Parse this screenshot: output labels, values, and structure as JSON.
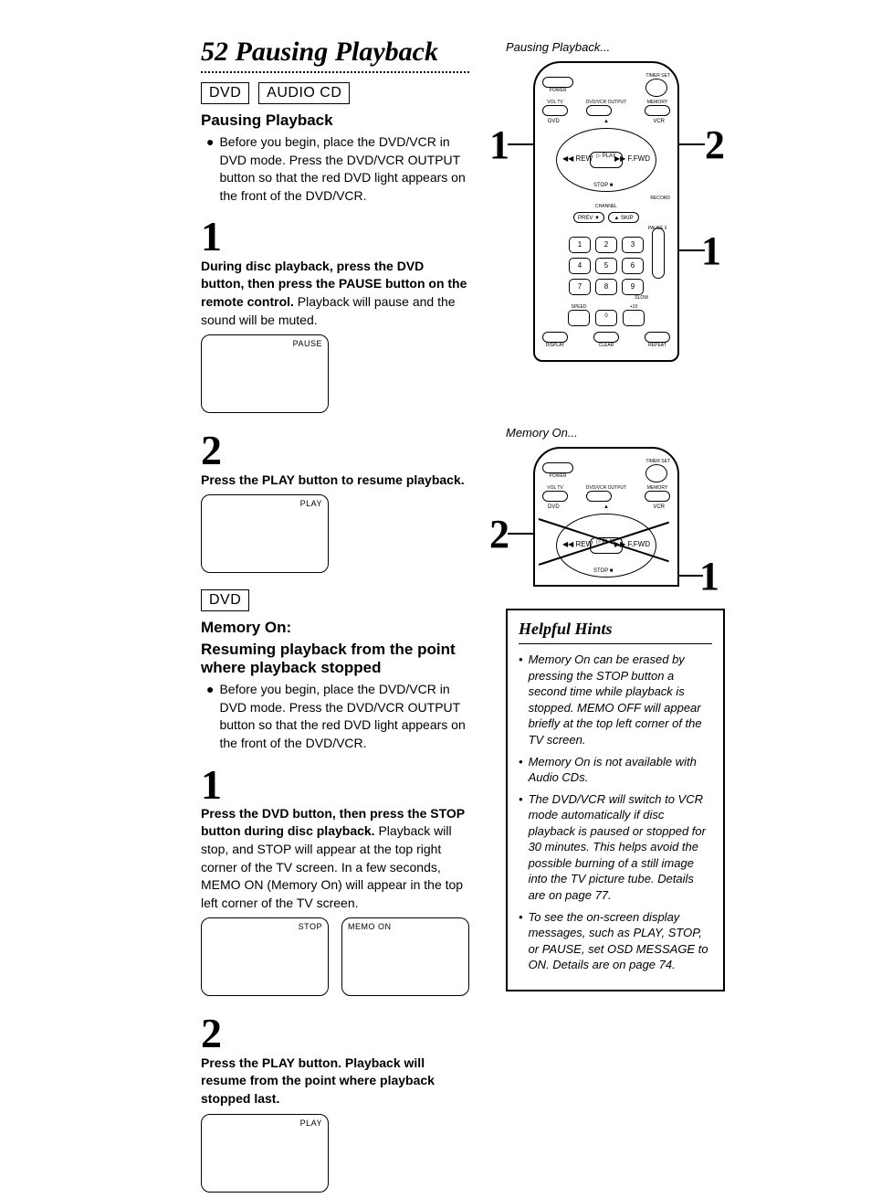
{
  "page_number": "52",
  "page_title": "Pausing Playback",
  "badges": {
    "dvd": "DVD",
    "audiocd": "AUDIO CD"
  },
  "sec1": {
    "heading": "Pausing Playback",
    "bullet": "Before you begin, place the DVD/VCR in DVD mode. Press the DVD/VCR OUTPUT button so that the red DVD light appears on the front of the DVD/VCR.",
    "step1_num": "1",
    "step1_b": "During disc playback, press the DVD button, then press the PAUSE button on the remote control.",
    "step1_r": " Playback will pause and the sound will be muted.",
    "tv_pause": "PAUSE",
    "step2_num": "2",
    "step2_b": "Press the PLAY button to resume playback.",
    "tv_play": "PLAY"
  },
  "sec2": {
    "badge": "DVD",
    "h1": "Memory On:",
    "h2": "Resuming playback from the point where playback stopped",
    "bullet": "Before you begin, place the DVD/VCR in DVD mode. Press the DVD/VCR OUTPUT button so that the red DVD light appears on the front of the DVD/VCR.",
    "step1_num": "1",
    "step1_b": "Press the DVD button, then press the STOP button during disc playback.",
    "step1_r": " Playback will stop, and STOP will appear at the top right corner of the TV screen. In a few seconds, MEMO ON (Memory On) will appear in the top left corner of the TV screen.",
    "tv_stop": "STOP",
    "tv_memo": "MEMO ON",
    "step2_num": "2",
    "step2_b": "Press the PLAY button. Playback will resume from the point where playback stopped last.",
    "tv_play": "PLAY"
  },
  "right": {
    "cap1": "Pausing Playback...",
    "cap2": "Memory On...",
    "indic1": "1",
    "indic2": "2",
    "remote": {
      "power": "POWER",
      "timerset": "TIMER SET",
      "volTv": "VOL TV",
      "dvdvcr": "DVD/VCR OUTPUT",
      "memory": "MEMORY",
      "dvd": "DVD",
      "vcr": "VCR",
      "play": "▷ PLAY",
      "rew": "◀◀ REW",
      "ffwd": "▶▶ F.FWD",
      "stop": "STOP ■",
      "record": "RECORD",
      "channel": "CHANNEL",
      "prev": "PREV ▼",
      "skip": "▲ SKIP",
      "speed": "SPEED",
      "plus10": "+10",
      "slow": "SLOW",
      "pause": "PAUSE ‖",
      "display": "DISPLAY",
      "clear": "CLEAR",
      "repeat": "REPEAT",
      "n1": "1",
      "n2": "2",
      "n3": "3",
      "n4": "4",
      "n5": "5",
      "n6": "6",
      "n7": "7",
      "n8": "8",
      "n9": "9",
      "n0": "0"
    }
  },
  "hints": {
    "title": "Helpful Hints",
    "i1": "Memory On can be erased by pressing the STOP button a second time while playback is stopped. MEMO OFF will appear briefly at the top left corner of the TV screen.",
    "i2": "Memory On is not available with Audio CDs.",
    "i3": "The DVD/VCR will switch to VCR mode automatically if disc playback is paused or stopped for 30 minutes. This helps avoid the possible burning of a still image into the TV picture tube. Details are on page 77.",
    "i4": "To see the on-screen display messages, such as PLAY, STOP, or PAUSE, set OSD MESSAGE to ON. Details are on page 74."
  }
}
